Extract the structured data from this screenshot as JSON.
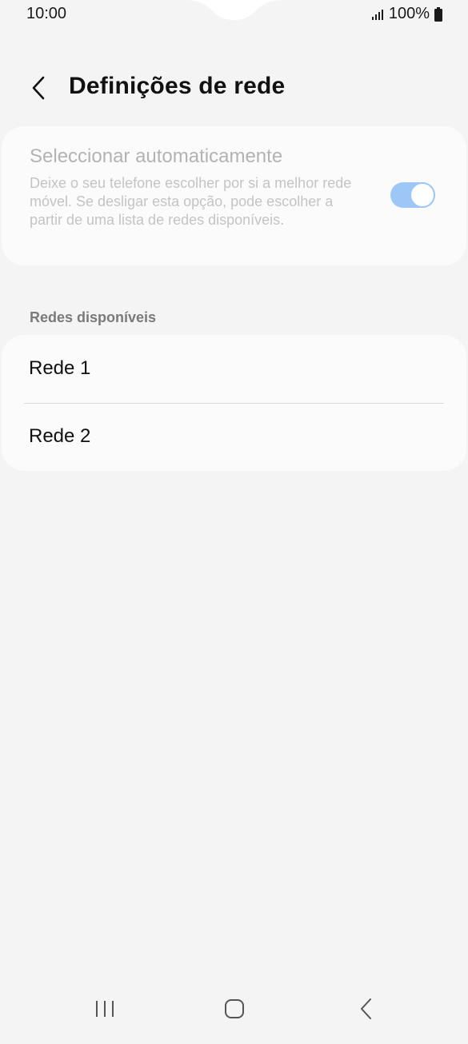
{
  "status_bar": {
    "time": "10:00",
    "battery": "100%",
    "icons": [
      "signal-icon",
      "battery-icon"
    ]
  },
  "header": {
    "title": "Definições de rede",
    "back_icon": "back-arrow-icon"
  },
  "auto_select": {
    "title": "Seleccionar automaticamente",
    "description": "Deixe o seu telefone escolher por si a melhor rede móvel. Se desligar esta opção, pode escolher a partir de uma lista de redes disponíveis.",
    "toggle_on": true,
    "enabled": false
  },
  "networks": {
    "section_label": "Redes disponíveis",
    "items": [
      {
        "label": "Rede 1"
      },
      {
        "label": "Rede 2"
      }
    ]
  },
  "nav_bar": {
    "icons": [
      "recent-apps-icon",
      "home-icon",
      "back-icon"
    ]
  },
  "colors": {
    "background": "#f4f4f4",
    "card": "#fbfbfb",
    "toggle": "#9cc7f7",
    "disabled_text": "#b3b3b3"
  }
}
